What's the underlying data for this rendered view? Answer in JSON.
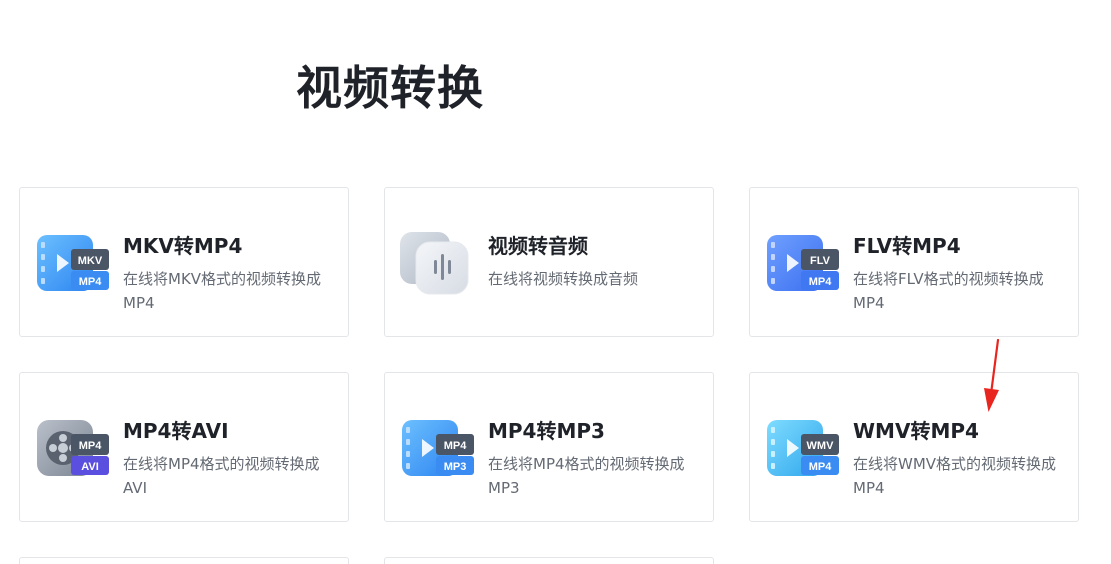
{
  "page": {
    "title": "视频转换"
  },
  "cards": [
    {
      "title": "MKV转MP4",
      "desc": "在线将MKV格式的视频转换成MP4",
      "icon": "mkv-to-mp4-icon",
      "badge_top": "MKV",
      "badge_bottom": "MP4",
      "color": "#3f9cf5"
    },
    {
      "title": "视频转音频",
      "desc": "在线将视频转换成音频",
      "icon": "audio-wave-icon",
      "color": "#c9cfd9"
    },
    {
      "title": "FLV转MP4",
      "desc": "在线将FLV格式的视频转换成MP4",
      "icon": "flv-to-mp4-icon",
      "badge_top": "FLV",
      "badge_bottom": "MP4",
      "color": "#4f86f7"
    },
    {
      "title": "MP4转AVI",
      "desc": "在线将MP4格式的视频转换成AVI",
      "icon": "mp4-to-avi-icon",
      "badge_top": "MP4",
      "badge_bottom": "AVI",
      "color": "#8e96a3"
    },
    {
      "title": "MP4转MP3",
      "desc": "在线将MP4格式的视频转换成MP3",
      "icon": "mp4-to-mp3-icon",
      "badge_top": "MP4",
      "badge_bottom": "MP3",
      "color": "#3f9cf5"
    },
    {
      "title": "WMV转MP4",
      "desc": "在线将WMV格式的视频转换成MP4",
      "icon": "wmv-to-mp4-icon",
      "badge_top": "WMV",
      "badge_bottom": "MP4",
      "color": "#45b8f0"
    }
  ],
  "annotation": {
    "arrow_color": "#e8261f"
  }
}
